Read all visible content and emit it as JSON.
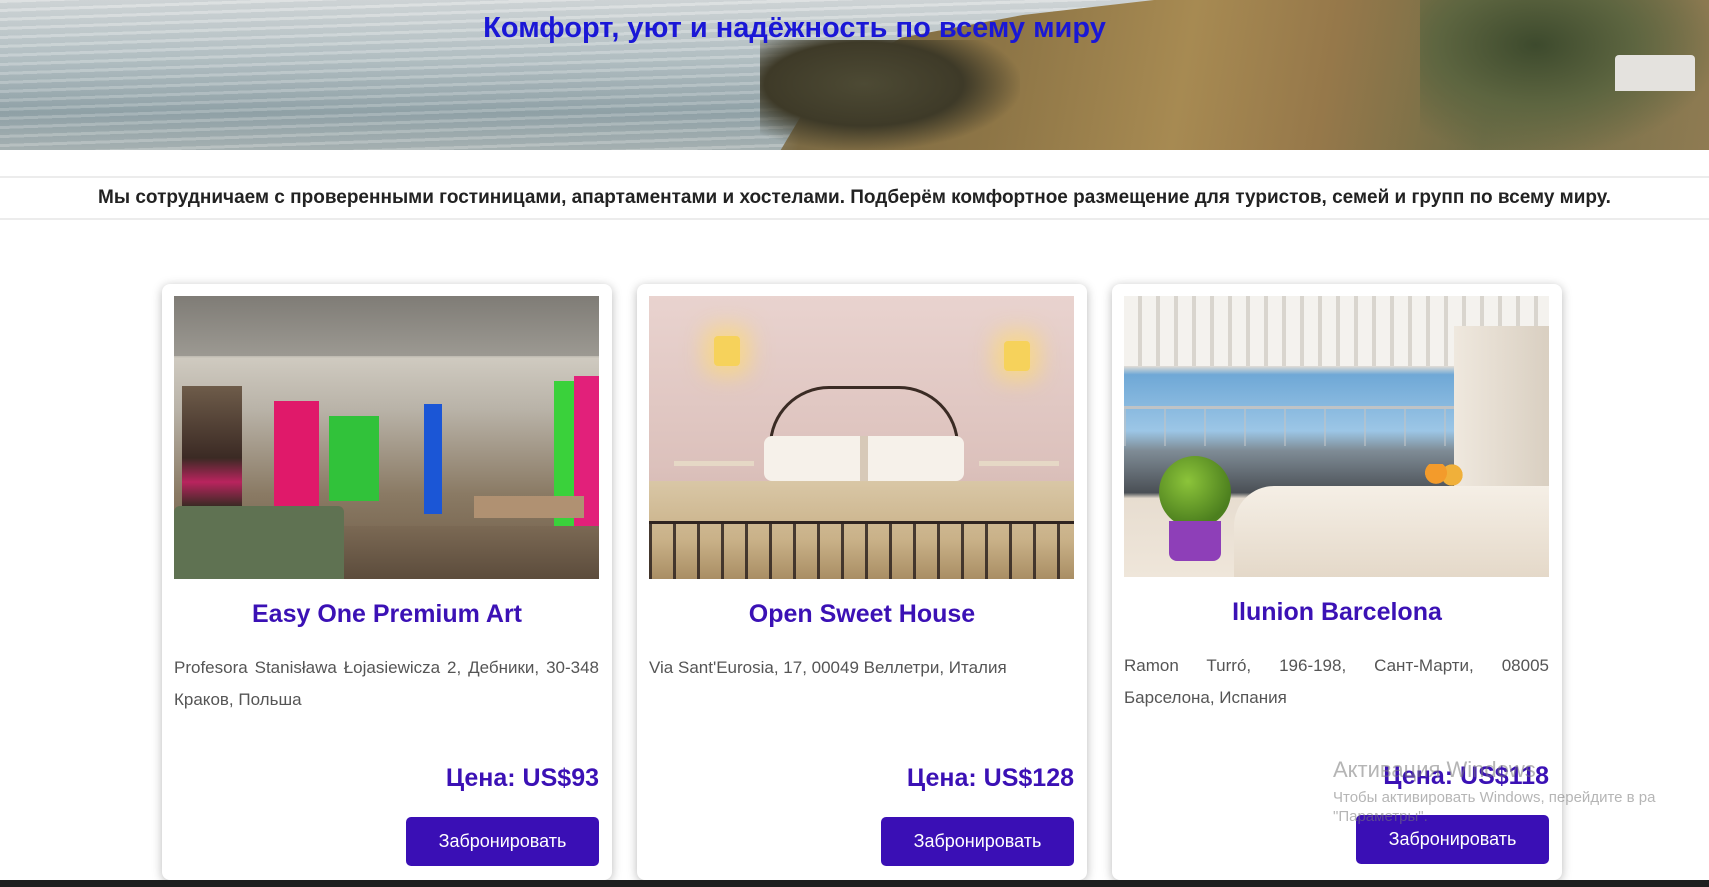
{
  "hero": {
    "title": "Комфорт, уют и надёжность по всему миру"
  },
  "tagline": "Мы сотрудничаем с проверенными гостиницами, апартаментами и хостелами. Подберём комфортное размещение для туристов, семей и групп по всему миру.",
  "hotels": [
    {
      "name": "Easy One Premium Art",
      "address": "Profesora Stanisława Łojasiewicza 2, Дебники, 30-348 Краков, Польша",
      "price": "Цена: US$93",
      "button": "Забронировать"
    },
    {
      "name": "Open Sweet House",
      "address": "Via Sant'Eurosia, 17, 00049 Веллетри, Италия",
      "price": "Цена: US$128",
      "button": "Забронировать"
    },
    {
      "name": "Ilunion Barcelona",
      "address": "Ramon Turró, 196-198, Сант-Марти, 08005 Барселона, Испания",
      "price": "Цена: US$118",
      "button": "Забронировать"
    }
  ],
  "watermark": {
    "line1": "Активация Windows",
    "line2": "Чтобы активировать Windows, перейдите в ра",
    "line3": "\"Параметры\"."
  },
  "colors": {
    "accent": "#3a0fb5",
    "title": "#1a17d6",
    "hotel_name": "#3b11b5"
  }
}
